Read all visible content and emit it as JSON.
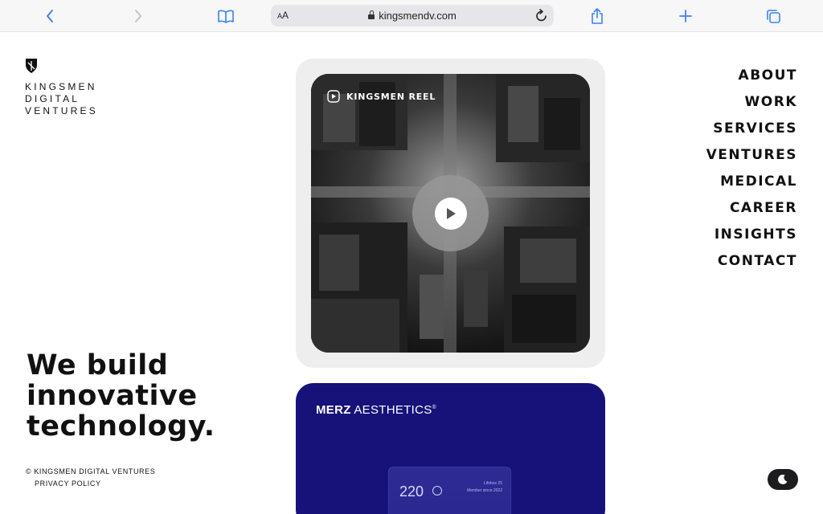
{
  "browser": {
    "aa_label_small": "A",
    "aa_label_big": "A",
    "url": "kingsmendv.com"
  },
  "logo": {
    "lines": [
      "KINGSMEN",
      "DIGITAL",
      "VENTURES"
    ]
  },
  "nav": {
    "items": [
      "ABOUT",
      "WORK",
      "SERVICES",
      "VENTURES",
      "MEDICAL",
      "CAREER",
      "INSIGHTS",
      "CONTACT"
    ]
  },
  "hero": {
    "lines": [
      "We build",
      "innovative",
      "technology."
    ]
  },
  "footer": {
    "copyright": "© KINGSMEN DIGITAL VENTURES",
    "privacy": "PRIVACY POLICY"
  },
  "reel": {
    "label": "KINGSMEN REEL"
  },
  "merz": {
    "brand_bold": "MERZ",
    "brand_light": " AESTHETICS",
    "reg": "®",
    "number": "220",
    "meta_line1": "Lifebox 25",
    "meta_line2": "Member since 2022"
  },
  "colors": {
    "merz_bg": "#16127a",
    "text": "#111111",
    "toolbar_icon": "#3b82f6"
  },
  "icons": {
    "back": "chevron-left-icon",
    "forward": "chevron-right-icon",
    "bookmarks": "book-icon",
    "share": "share-icon",
    "new_tab": "plus-icon",
    "tabs": "tabs-icon",
    "reload": "reload-icon",
    "play": "play-icon",
    "theme": "moon-icon"
  }
}
